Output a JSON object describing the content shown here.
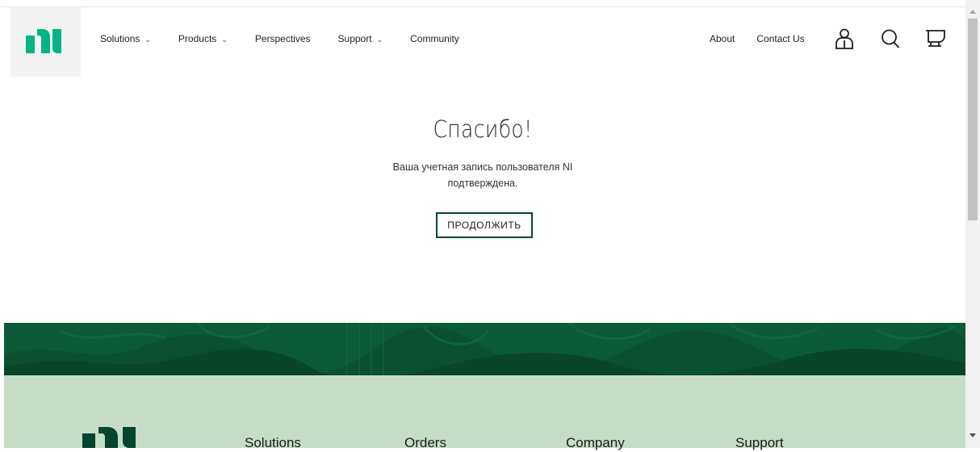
{
  "header": {
    "logo": "ni-logo",
    "nav": [
      {
        "label": "Solutions",
        "has_dropdown": true
      },
      {
        "label": "Products",
        "has_dropdown": true
      },
      {
        "label": "Perspectives",
        "has_dropdown": false
      },
      {
        "label": "Support",
        "has_dropdown": true
      },
      {
        "label": "Community",
        "has_dropdown": false
      }
    ],
    "right_links": [
      "About",
      "Contact Us"
    ],
    "icons": [
      "user-icon",
      "search-icon",
      "cart-icon"
    ]
  },
  "main": {
    "title": "Спасибо!",
    "message": "Ваша учетная запись пользователя NI подтверждена.",
    "continue_label": "ПРОДОЛЖИТЬ"
  },
  "footer": {
    "columns": [
      "Solutions",
      "Orders",
      "Company",
      "Support"
    ]
  },
  "colors": {
    "brand_green": "#03b585",
    "dark_green": "#03452f",
    "banner_green": "#0b5a38",
    "footer_bg": "#c6dcc7"
  }
}
